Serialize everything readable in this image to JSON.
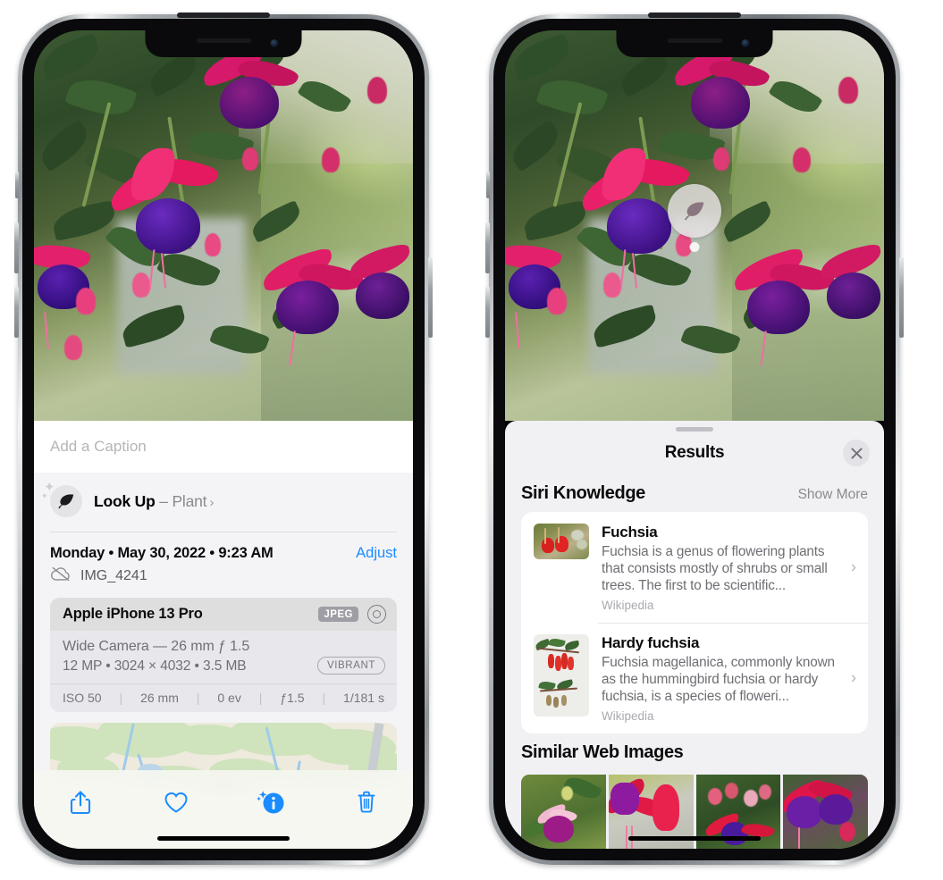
{
  "left_phone": {
    "name": "photos-detail-view",
    "caption_placeholder": "Add a Caption",
    "caption_value": "",
    "lookup": {
      "label": "Look Up",
      "dash": " – ",
      "subject": "Plant",
      "chevron": "›",
      "icon": "leaf-icon",
      "sparkle": "✦"
    },
    "date_line": "Monday • May 30, 2022 • 9:23 AM",
    "adjust_label": "Adjust",
    "file_name": "IMG_4241",
    "cloud_icon": "cloud-slash-icon",
    "camera": {
      "model": "Apple iPhone 13 Pro",
      "format_badge": "JPEG",
      "raw_icon": "raw-ring-icon",
      "lens_line": "Wide Camera — 26 mm ƒ 1.5",
      "specs_line": "12 MP • 3024 × 4032 • 3.5 MB",
      "style_badge": "VIBRANT",
      "exif": [
        "ISO 50",
        "26 mm",
        "0 ev",
        "ƒ1.5",
        "1/181 s"
      ],
      "exif_separator": "|"
    },
    "map": {
      "name": "location-map-preview"
    },
    "toolbar": [
      {
        "name": "share-button",
        "icon": "share-icon"
      },
      {
        "name": "favorite-button",
        "icon": "heart-icon"
      },
      {
        "name": "info-button",
        "icon": "info-sparkle-icon"
      },
      {
        "name": "delete-button",
        "icon": "trash-icon"
      }
    ],
    "accent_blue": "#1a8cff"
  },
  "right_phone": {
    "name": "visual-lookup-results-view",
    "badge": {
      "name": "lookup-leaf-badge",
      "icon": "leaf-icon"
    },
    "sheet_title": "Results",
    "close_label": "✕",
    "sections": [
      {
        "title": "Siri Knowledge",
        "action": "Show More",
        "items": [
          {
            "title": "Fuchsia",
            "description": "Fuchsia is a genus of flowering plants that consists mostly of shrubs or small trees. The first to be scientific...",
            "source": "Wikipedia",
            "thumb": "fuchsia-red-flowers-thumb",
            "chevron": "›"
          },
          {
            "title": "Hardy fuchsia",
            "description": "Fuchsia magellanica, commonly known as the hummingbird fuchsia or hardy fuchsia, is a species of floweri...",
            "source": "Wikipedia",
            "thumb": "hardy-fuchsia-specimen-thumb",
            "chevron": "›"
          }
        ]
      },
      {
        "title": "Similar Web Images",
        "items": [
          {
            "thumb": "web-image-1"
          },
          {
            "thumb": "web-image-2"
          },
          {
            "thumb": "web-image-3"
          },
          {
            "thumb": "web-image-4"
          }
        ]
      }
    ]
  },
  "colors": {
    "accent_blue": "#1a8cff",
    "sheet_gray": "#f1f1f4",
    "card_white": "#ffffff",
    "secondary_text": "#6e6e74",
    "tertiary_text": "#a9a9af",
    "flower_pink": "#e81f6d",
    "flower_purple": "#4b1a96"
  }
}
